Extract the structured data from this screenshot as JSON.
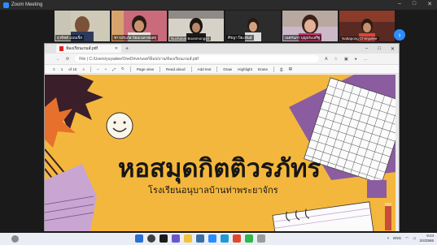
{
  "zoom": {
    "title": "Zoom Meeting",
    "controls": [
      "–",
      "□",
      "✕"
    ]
  },
  "participants": [
    {
      "name": "ยุวพิชต์ แบบเช็ก"
    },
    {
      "name": "ชาวประภัส ป้อมเนลาสมสกุ"
    },
    {
      "name": "Nuchanat Boonmongsri"
    },
    {
      "name": "ศิรญา ปิยะพันธ์"
    },
    {
      "name": "เนตรนภา บุญประเสริฐ"
    },
    {
      "name": "Nattapong Chimpalee"
    }
  ],
  "browser": {
    "tab_label": "ห้องเรียนเกมส์.pdf",
    "url": "File  |  C:/Users/yuyadee/OneDrive/เดสก์ท็อป/งาน/ห้องเรียนเกมส์.pdf",
    "window_controls": [
      "–",
      "□",
      "✕"
    ],
    "pdf_toolbar": {
      "page": "1",
      "page_total": "of 15",
      "zoom_out": "–",
      "zoom_in": "+",
      "page_view": "Page view",
      "read_aloud": "Read aloud",
      "add_text": "Add text",
      "draw": "Draw",
      "highlight": "Highlight",
      "erase": "Erase"
    }
  },
  "slide": {
    "title": "หอสมุดกิตติวรภัทร",
    "subtitle": "โรงเรียนอนุบาลบ้านท่าพระยาจักร"
  },
  "taskbar": {
    "weather": "ENG",
    "time": "9:24",
    "date": "2/4/2565"
  },
  "colors": {
    "slide_bg": "#f4b73d",
    "purple": "#8b5da0",
    "zoom_blue": "#2d8cff"
  }
}
